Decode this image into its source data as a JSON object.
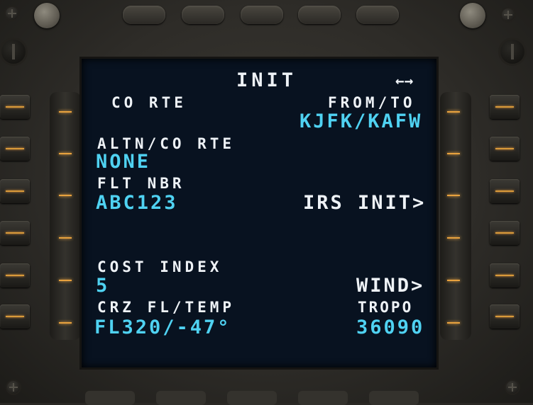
{
  "page": {
    "title": "INIT",
    "page_arrow": "←→"
  },
  "left": {
    "co_rte_label": "CO RTE",
    "altn_label": "ALTN/CO RTE",
    "altn_value": "NONE",
    "flt_nbr_label": "FLT NBR",
    "flt_nbr_value": "ABC123",
    "cost_index_label": "COST INDEX",
    "cost_index_value": "5",
    "crz_label": "CRZ FL/TEMP",
    "crz_value": "FL320/-47°"
  },
  "right": {
    "from_to_label": "FROM/TO",
    "from_to_value": "KJFK/KAFW",
    "irs_init": "IRS INIT>",
    "wind": "WIND>",
    "tropo_label": "TROPO",
    "tropo_value": "36090"
  },
  "colors": {
    "label": "#eef2f6",
    "data": "#4fd2f2",
    "screen": "#081220",
    "lsk_light": "#e8a23e"
  }
}
